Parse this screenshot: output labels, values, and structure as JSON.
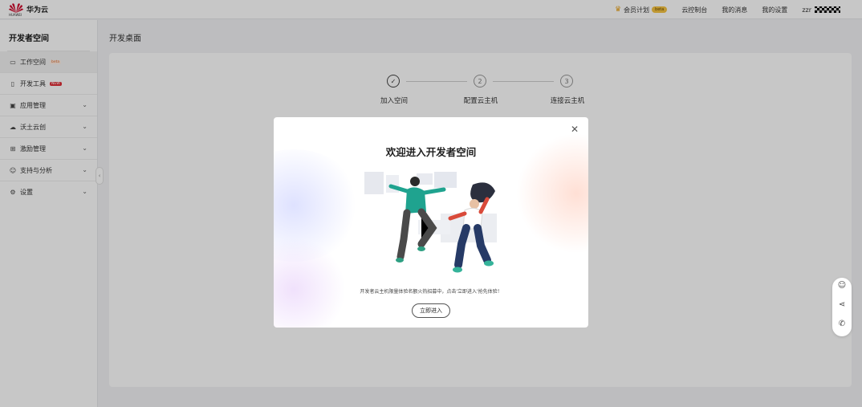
{
  "topbar": {
    "brand": "华为云",
    "logo_sub": "HUAWEI",
    "member_plan": "会员计划",
    "member_badge": "beta",
    "console": "云控制台",
    "messages": "我的消息",
    "settings": "我的设置",
    "user": "zzr"
  },
  "sidebar": {
    "title": "开发者空间",
    "items": [
      {
        "label": "工作空间",
        "tag": "beta",
        "icon": "monitor-icon"
      },
      {
        "label": "开发工具",
        "tag": "NEW",
        "icon": "document-icon"
      },
      {
        "label": "应用管理",
        "icon": "app-icon"
      },
      {
        "label": "沃土云创",
        "icon": "cloud-icon"
      },
      {
        "label": "激励管理",
        "icon": "gift-icon"
      },
      {
        "label": "支持与分析",
        "icon": "support-icon"
      },
      {
        "label": "设置",
        "icon": "gear-icon"
      }
    ]
  },
  "main": {
    "page_title": "开发桌面",
    "steps": [
      {
        "num": "1",
        "label": "加入空间",
        "done": true
      },
      {
        "num": "2",
        "label": "配置云主机",
        "done": false
      },
      {
        "num": "3",
        "label": "连接云主机",
        "done": false
      }
    ]
  },
  "modal": {
    "title": "欢迎进入开发者空间",
    "description": "开发者云主机限量体验名额火热招募中，点击'立即进入'抢先体验！",
    "enter_button": "立即进入",
    "close_icon": "close-icon"
  },
  "float_tools": [
    "smile-icon",
    "share-icon",
    "phone-icon"
  ],
  "colors": {
    "brand_red": "#cf0a2c",
    "accent_gold": "#f5c342"
  }
}
